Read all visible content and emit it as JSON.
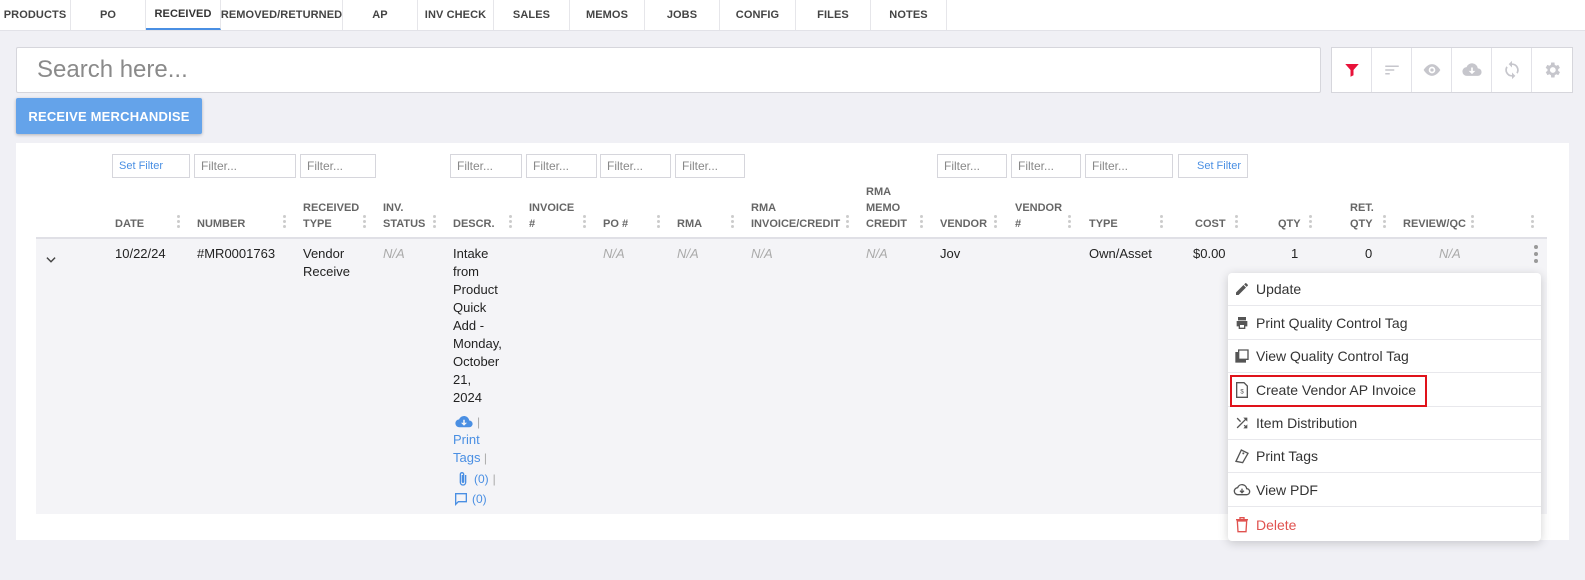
{
  "tabs": [
    {
      "label": "PRODUCTS",
      "active": false
    },
    {
      "label": "PO",
      "active": false
    },
    {
      "label": "RECEIVED",
      "active": true
    },
    {
      "label": "REMOVED/RETURNED",
      "active": false
    },
    {
      "label": "AP",
      "active": false
    },
    {
      "label": "INV CHECK",
      "active": false
    },
    {
      "label": "SALES",
      "active": false
    },
    {
      "label": "MEMOS",
      "active": false
    },
    {
      "label": "JOBS",
      "active": false
    },
    {
      "label": "CONFIG",
      "active": false
    },
    {
      "label": "FILES",
      "active": false
    },
    {
      "label": "NOTES",
      "active": false
    }
  ],
  "search": {
    "placeholder": "Search here..."
  },
  "toolbar": {
    "filter_color": "#e8123a",
    "icon_color": "#c6c6cc",
    "icons": [
      "filter-icon",
      "sort-icon",
      "eye-icon",
      "cloud-download-icon",
      "sync-icon",
      "gear-icon"
    ]
  },
  "receive_button": {
    "label": "RECEIVE MERCHANDISE"
  },
  "filters": {
    "set_filter": "Set Filter",
    "placeholder": "Filter..."
  },
  "columns": {
    "date": "DATE",
    "number": "NUMBER",
    "received_type": [
      "RECEIVED",
      "TYPE"
    ],
    "inv_status": [
      "INV.",
      "STATUS"
    ],
    "descr": "DESCR.",
    "invoice": [
      "INVOICE",
      "#"
    ],
    "po": "PO #",
    "rma": "RMA",
    "rma_invoice": [
      "RMA",
      "INVOICE/CREDIT"
    ],
    "rma_memo": [
      "RMA",
      "MEMO",
      "CREDIT"
    ],
    "vendor": "VENDOR",
    "vendor_num": [
      "VENDOR",
      "#"
    ],
    "type": "TYPE",
    "cost": "COST",
    "qty": "QTY",
    "ret_qty": [
      "RET.",
      "QTY"
    ],
    "review": "REVIEW/QC"
  },
  "row": {
    "date": "10/22/24",
    "number": "#MR0001763",
    "received_type": [
      "Vendor",
      "Receive"
    ],
    "inv_status": "N/A",
    "descr": [
      "Intake",
      "from",
      "Product",
      "Quick",
      "Add -",
      "Monday,",
      "October",
      "21,",
      "2024"
    ],
    "print_tags": [
      "Print",
      "Tags"
    ],
    "separator": "|",
    "attachments": "(0)",
    "comments": "(0)",
    "po": "N/A",
    "rma": "N/A",
    "rma_invoice": "N/A",
    "rma_memo": "N/A",
    "vendor": "Jov",
    "type": "Own/Asset",
    "cost": "$0.00",
    "qty": "1",
    "ret_qty": "0",
    "review": "N/A"
  },
  "menu": [
    {
      "label": "Update",
      "icon": "pencil-icon"
    },
    {
      "label": "Print Quality Control Tag",
      "icon": "printer-icon"
    },
    {
      "label": "View Quality Control Tag",
      "icon": "gallery-icon"
    },
    {
      "label": "Create Vendor AP Invoice",
      "icon": "invoice-icon",
      "highlighted": true
    },
    {
      "label": "Item Distribution",
      "icon": "shuffle-icon"
    },
    {
      "label": "Print Tags",
      "icon": "tags-icon"
    },
    {
      "label": "View PDF",
      "icon": "cloud-download-icon"
    },
    {
      "label": "Delete",
      "icon": "trash-icon",
      "color": "#e0524f"
    }
  ]
}
